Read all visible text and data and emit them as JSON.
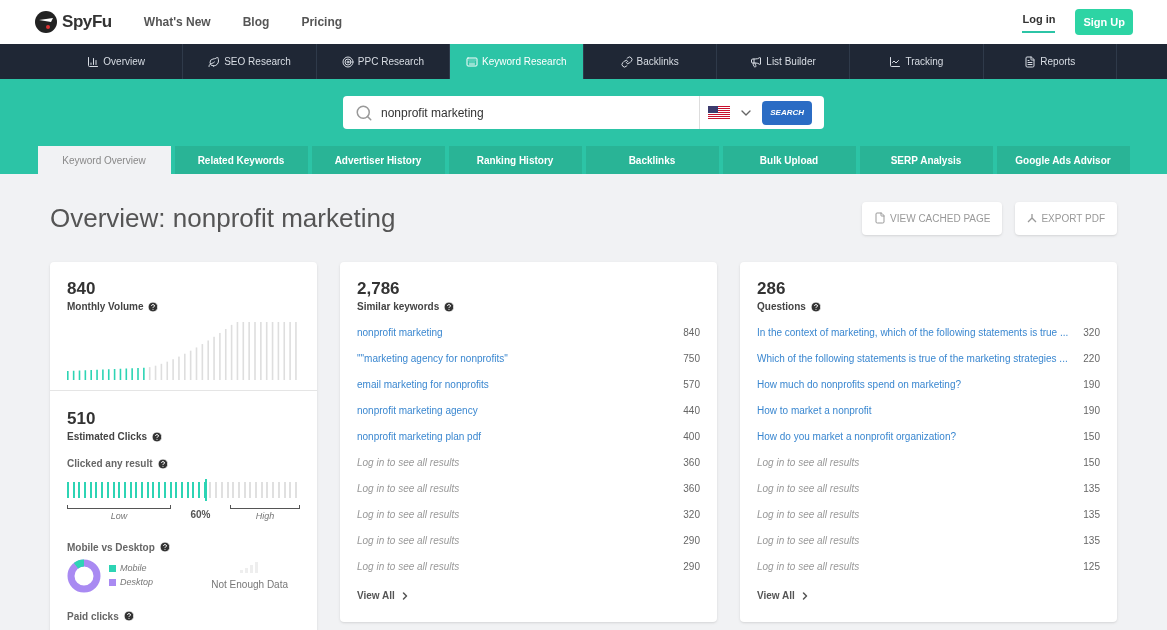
{
  "header": {
    "logo": "SpyFu",
    "links": [
      "What's New",
      "Blog",
      "Pricing"
    ],
    "login": "Log in",
    "signup": "Sign Up"
  },
  "nav": [
    {
      "label": "Overview",
      "selected": false
    },
    {
      "label": "SEO Research",
      "selected": false
    },
    {
      "label": "PPC Research",
      "selected": false
    },
    {
      "label": "Keyword Research",
      "selected": true
    },
    {
      "label": "Backlinks",
      "selected": false
    },
    {
      "label": "List Builder",
      "selected": false
    },
    {
      "label": "Tracking",
      "selected": false
    },
    {
      "label": "Reports",
      "selected": false
    }
  ],
  "search": {
    "value": "nonprofit marketing",
    "button": "SEARCH"
  },
  "subtabs": [
    {
      "label": "Keyword Overview",
      "selected": true
    },
    {
      "label": "Related Keywords",
      "selected": false
    },
    {
      "label": "Advertiser History",
      "selected": false
    },
    {
      "label": "Ranking History",
      "selected": false
    },
    {
      "label": "Backlinks",
      "selected": false
    },
    {
      "label": "Bulk Upload",
      "selected": false
    },
    {
      "label": "SERP Analysis",
      "selected": false
    },
    {
      "label": "Google Ads Advisor",
      "selected": false
    }
  ],
  "page_title": "Overview: nonprofit marketing",
  "actions": [
    "VIEW CACHED PAGE",
    "EXPORT PDF"
  ],
  "volume": {
    "value": "840",
    "label": "Monthly Volume"
  },
  "clicks": {
    "value": "510",
    "label": "Estimated Clicks",
    "clicked_label": "Clicked any result",
    "reading": "60%",
    "low": "Low",
    "high": "High"
  },
  "mobile": {
    "label": "Mobile vs Desktop",
    "legend": [
      {
        "label": "Mobile",
        "color": "#2dd4b4"
      },
      {
        "label": "Desktop",
        "color": "#a98af2"
      }
    ],
    "no_data": "Not Enough Data"
  },
  "paid": {
    "label": "Paid clicks"
  },
  "lists": [
    {
      "value": "2,786",
      "label": "Similar keywords",
      "view_all": "View All",
      "rows": [
        {
          "text": "nonprofit marketing",
          "count": "840",
          "kind": "link"
        },
        {
          "text": "\"\"marketing agency for nonprofits\"",
          "count": "750",
          "kind": "link"
        },
        {
          "text": "email marketing for nonprofits",
          "count": "570",
          "kind": "link"
        },
        {
          "text": "nonprofit marketing agency",
          "count": "440",
          "kind": "link"
        },
        {
          "text": "nonprofit marketing plan pdf",
          "count": "400",
          "kind": "link"
        },
        {
          "text": "Log in to see all results",
          "count": "360",
          "kind": "locked"
        },
        {
          "text": "Log in to see all results",
          "count": "360",
          "kind": "locked"
        },
        {
          "text": "Log in to see all results",
          "count": "320",
          "kind": "locked"
        },
        {
          "text": "Log in to see all results",
          "count": "290",
          "kind": "locked"
        },
        {
          "text": "Log in to see all results",
          "count": "290",
          "kind": "locked"
        }
      ]
    },
    {
      "value": "286",
      "label": "Questions",
      "view_all": "View All",
      "rows": [
        {
          "text": "In the context of marketing, which of the following statements is true ...",
          "count": "320",
          "kind": "link"
        },
        {
          "text": "Which of the following statements is true of the marketing strategies ...",
          "count": "220",
          "kind": "link"
        },
        {
          "text": "How much do nonprofits spend on marketing?",
          "count": "190",
          "kind": "link"
        },
        {
          "text": "How to market a nonprofit",
          "count": "190",
          "kind": "link"
        },
        {
          "text": "How do you market a nonprofit organization?",
          "count": "150",
          "kind": "link"
        },
        {
          "text": "Log in to see all results",
          "count": "150",
          "kind": "locked"
        },
        {
          "text": "Log in to see all results",
          "count": "135",
          "kind": "locked"
        },
        {
          "text": "Log in to see all results",
          "count": "135",
          "kind": "locked"
        },
        {
          "text": "Log in to see all results",
          "count": "135",
          "kind": "locked"
        },
        {
          "text": "Log in to see all results",
          "count": "125",
          "kind": "locked"
        }
      ]
    }
  ]
}
